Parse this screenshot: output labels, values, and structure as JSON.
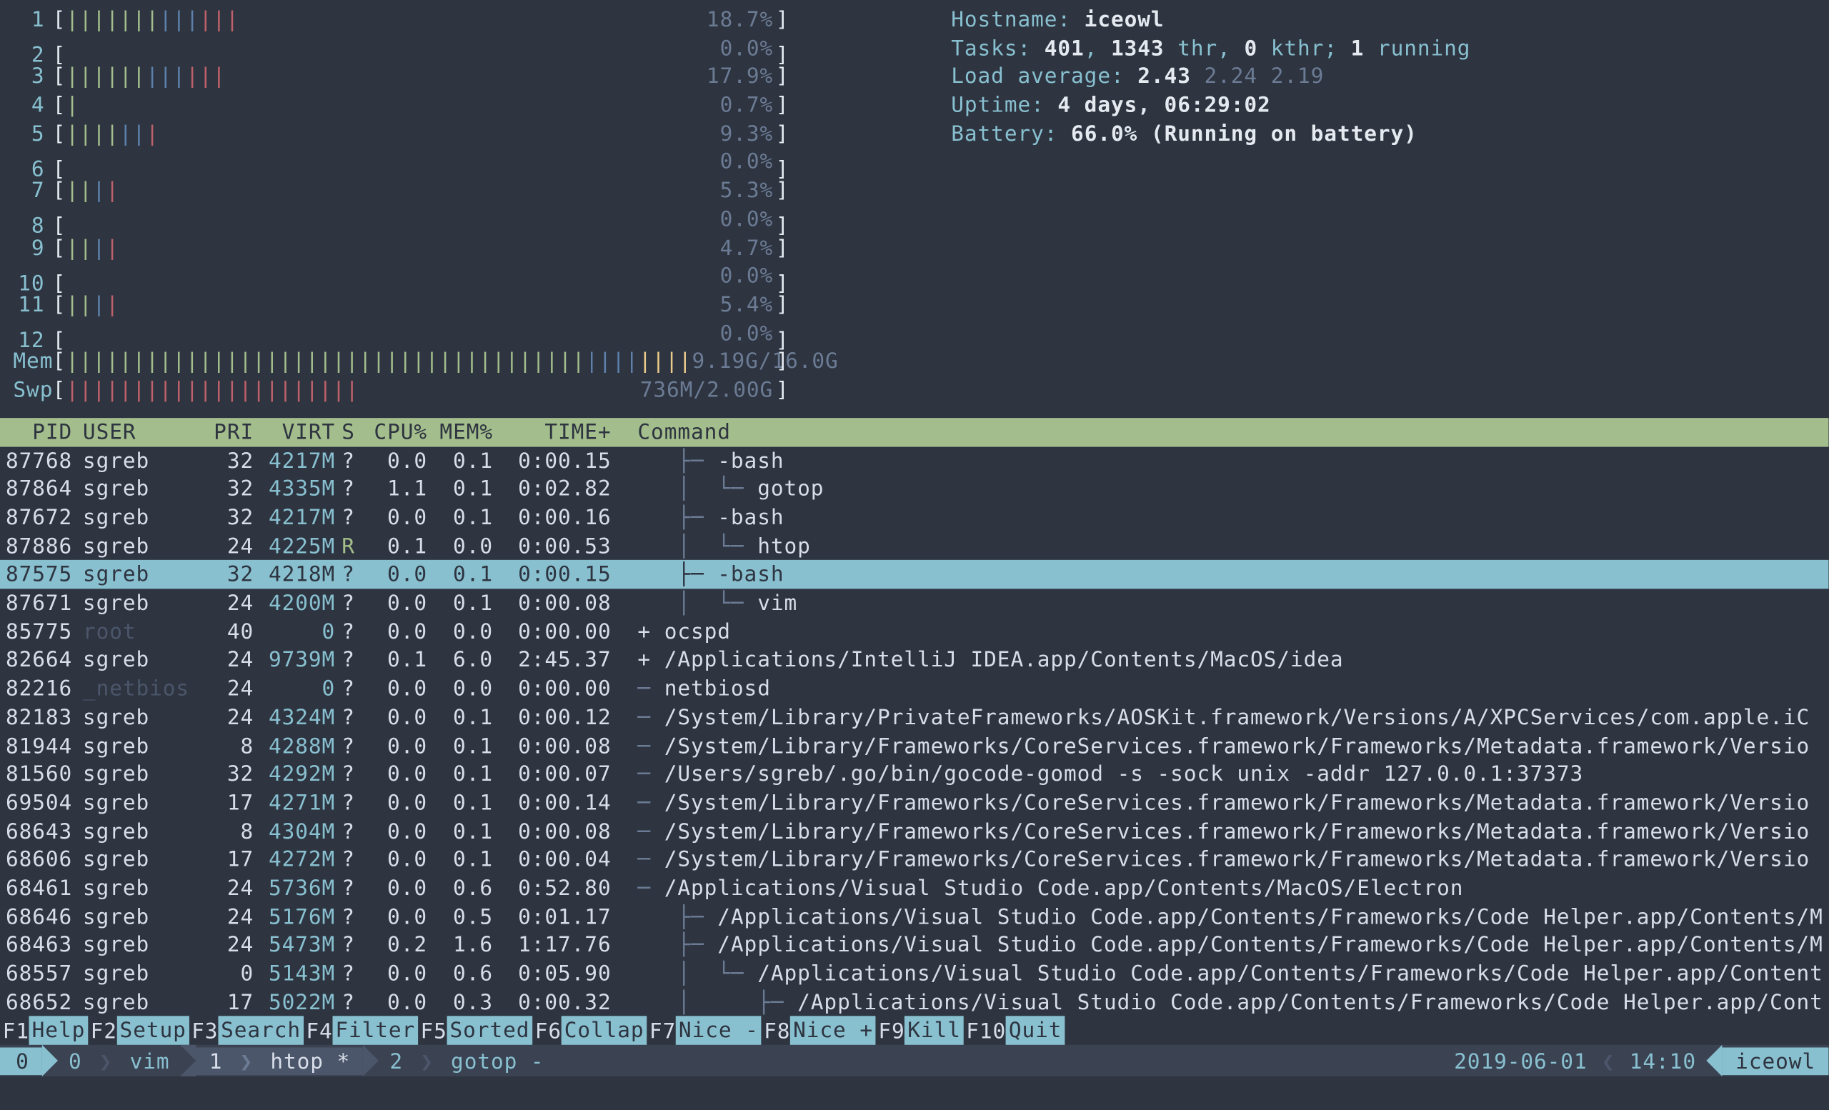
{
  "cpus": [
    {
      "n": "1",
      "bars": "|||||||||||||",
      "pct": "18.7%"
    },
    {
      "n": "2",
      "bars": "",
      "pct": "0.0%"
    },
    {
      "n": "3",
      "bars": "||||||||||||",
      "pct": "17.9%"
    },
    {
      "n": "4",
      "bars": "|",
      "pct": "0.7%"
    },
    {
      "n": "5",
      "bars": "|||||||",
      "pct": "9.3%"
    },
    {
      "n": "6",
      "bars": "",
      "pct": "0.0%"
    },
    {
      "n": "7",
      "bars": "||||",
      "pct": "5.3%"
    },
    {
      "n": "8",
      "bars": "",
      "pct": "0.0%"
    },
    {
      "n": "9",
      "bars": "||||",
      "pct": "4.7%"
    },
    {
      "n": "10",
      "bars": "",
      "pct": "0.0%"
    },
    {
      "n": "11",
      "bars": "||||",
      "pct": "5.4%"
    },
    {
      "n": "12",
      "bars": "",
      "pct": "0.0%"
    }
  ],
  "mem": {
    "label": "Mem",
    "bars_g": "|||||||||||||||||||||||||||||||||||||||",
    "bars_b": "||||",
    "bars_y": "||||",
    "val": "9.19G/16.0G"
  },
  "swp": {
    "label": "Swp",
    "bars_r": "||||||||||||||||||||||",
    "val": "736M/2.00G"
  },
  "info": {
    "hostname_label": "Hostname: ",
    "hostname": "iceowl",
    "tasks_label": "Tasks: ",
    "tasks": "401",
    "tasks_thr": "1343",
    "tasks_thr_label": " thr, ",
    "tasks_kthr": "0",
    "tasks_kthr_label": " kthr; ",
    "tasks_running": "1",
    "tasks_running_label": " running",
    "load_label": "Load average: ",
    "load1": "2.43",
    "load2": "2.24",
    "load3": "2.19",
    "uptime_label": "Uptime: ",
    "uptime": "4 days, 06:29:02",
    "battery_label": "Battery: ",
    "battery": "66.0% (Running on battery)"
  },
  "header": {
    "pid": "PID",
    "user": "USER",
    "pri": "PRI",
    "virt": "VIRT",
    "s": "S",
    "cpu": "CPU%",
    "mem": "MEM%",
    "time": "TIME+",
    "cmd": "Command"
  },
  "processes": [
    {
      "pid": "87768",
      "user": "sgreb",
      "pri": "32",
      "virt": "4217M",
      "s": "?",
      "cpu": "0.0",
      "mem": "0.1",
      "time": "0:00.15",
      "tree": "   ├─ ",
      "cmd": "-bash"
    },
    {
      "pid": "87864",
      "user": "sgreb",
      "pri": "32",
      "virt": "4335M",
      "s": "?",
      "cpu": "1.1",
      "mem": "0.1",
      "time": "0:02.82",
      "tree": "   │  └─ ",
      "cmd": "gotop"
    },
    {
      "pid": "87672",
      "user": "sgreb",
      "pri": "32",
      "virt": "4217M",
      "s": "?",
      "cpu": "0.0",
      "mem": "0.1",
      "time": "0:00.16",
      "tree": "   ├─ ",
      "cmd": "-bash"
    },
    {
      "pid": "87886",
      "user": "sgreb",
      "pri": "24",
      "virt": "4225M",
      "s": "R",
      "cpu": "0.1",
      "mem": "0.0",
      "time": "0:00.53",
      "tree": "   │  └─ ",
      "cmd": "htop",
      "stateR": true
    },
    {
      "pid": "87575",
      "user": "sgreb",
      "pri": "32",
      "virt": "4218M",
      "s": "?",
      "cpu": "0.0",
      "mem": "0.1",
      "time": "0:00.15",
      "tree": "   ├─ ",
      "cmd": "-bash",
      "selected": true
    },
    {
      "pid": "87671",
      "user": "sgreb",
      "pri": "24",
      "virt": "4200M",
      "s": "?",
      "cpu": "0.0",
      "mem": "0.1",
      "time": "0:00.08",
      "tree": "   │  └─ ",
      "cmd": "vim"
    },
    {
      "pid": "85775",
      "user": "root",
      "pri": "40",
      "virt": "0",
      "s": "?",
      "cpu": "0.0",
      "mem": "0.0",
      "time": "0:00.00",
      "tree": "",
      "pfx": "+ ",
      "cmd": "ocspd",
      "userDim": true
    },
    {
      "pid": "82664",
      "user": "sgreb",
      "pri": "24",
      "virt": "9739M",
      "s": "?",
      "cpu": "0.1",
      "mem": "6.0",
      "time": "2:45.37",
      "tree": "",
      "pfx": "+ ",
      "cmd": "/Applications/IntelliJ IDEA.app/Contents/MacOS/idea"
    },
    {
      "pid": "82216",
      "user": "_netbios",
      "pri": "24",
      "virt": "0",
      "s": "?",
      "cpu": "0.0",
      "mem": "0.0",
      "time": "0:00.00",
      "tree": "─ ",
      "cmd": "netbiosd",
      "userDim": true
    },
    {
      "pid": "82183",
      "user": "sgreb",
      "pri": "24",
      "virt": "4324M",
      "s": "?",
      "cpu": "0.0",
      "mem": "0.1",
      "time": "0:00.12",
      "tree": "─ ",
      "cmd": "/System/Library/PrivateFrameworks/AOSKit.framework/Versions/A/XPCServices/com.apple.iC"
    },
    {
      "pid": "81944",
      "user": "sgreb",
      "pri": "8",
      "virt": "4288M",
      "s": "?",
      "cpu": "0.0",
      "mem": "0.1",
      "time": "0:00.08",
      "tree": "─ ",
      "cmd": "/System/Library/Frameworks/CoreServices.framework/Frameworks/Metadata.framework/Versio"
    },
    {
      "pid": "81560",
      "user": "sgreb",
      "pri": "32",
      "virt": "4292M",
      "s": "?",
      "cpu": "0.0",
      "mem": "0.1",
      "time": "0:00.07",
      "tree": "─ ",
      "cmd": "/Users/sgreb/.go/bin/gocode-gomod -s -sock unix -addr 127.0.0.1:37373"
    },
    {
      "pid": "69504",
      "user": "sgreb",
      "pri": "17",
      "virt": "4271M",
      "s": "?",
      "cpu": "0.0",
      "mem": "0.1",
      "time": "0:00.14",
      "tree": "─ ",
      "cmd": "/System/Library/Frameworks/CoreServices.framework/Frameworks/Metadata.framework/Versio"
    },
    {
      "pid": "68643",
      "user": "sgreb",
      "pri": "8",
      "virt": "4304M",
      "s": "?",
      "cpu": "0.0",
      "mem": "0.1",
      "time": "0:00.08",
      "tree": "─ ",
      "cmd": "/System/Library/Frameworks/CoreServices.framework/Frameworks/Metadata.framework/Versio"
    },
    {
      "pid": "68606",
      "user": "sgreb",
      "pri": "17",
      "virt": "4272M",
      "s": "?",
      "cpu": "0.0",
      "mem": "0.1",
      "time": "0:00.04",
      "tree": "─ ",
      "cmd": "/System/Library/Frameworks/CoreServices.framework/Frameworks/Metadata.framework/Versio"
    },
    {
      "pid": "68461",
      "user": "sgreb",
      "pri": "24",
      "virt": "5736M",
      "s": "?",
      "cpu": "0.0",
      "mem": "0.6",
      "time": "0:52.80",
      "tree": "─ ",
      "cmd": "/Applications/Visual Studio Code.app/Contents/MacOS/Electron"
    },
    {
      "pid": "68646",
      "user": "sgreb",
      "pri": "24",
      "virt": "5176M",
      "s": "?",
      "cpu": "0.0",
      "mem": "0.5",
      "time": "0:01.17",
      "tree": "   ├─ ",
      "cmd": "/Applications/Visual Studio Code.app/Contents/Frameworks/Code Helper.app/Contents/M"
    },
    {
      "pid": "68463",
      "user": "sgreb",
      "pri": "24",
      "virt": "5473M",
      "s": "?",
      "cpu": "0.2",
      "mem": "1.6",
      "time": "1:17.76",
      "tree": "   ├─ ",
      "cmd": "/Applications/Visual Studio Code.app/Contents/Frameworks/Code Helper.app/Contents/M"
    },
    {
      "pid": "68557",
      "user": "sgreb",
      "pri": "0",
      "virt": "5143M",
      "s": "?",
      "cpu": "0.0",
      "mem": "0.6",
      "time": "0:05.90",
      "tree": "   │  └─ ",
      "cmd": "/Applications/Visual Studio Code.app/Contents/Frameworks/Code Helper.app/Content"
    },
    {
      "pid": "68652",
      "user": "sgreb",
      "pri": "17",
      "virt": "5022M",
      "s": "?",
      "cpu": "0.0",
      "mem": "0.3",
      "time": "0:00.32",
      "tree": "   │     ├─ ",
      "cmd": "/Applications/Visual Studio Code.app/Contents/Frameworks/Code Helper.app/Cont"
    }
  ],
  "footer": [
    {
      "key": "F1",
      "label": "Help  "
    },
    {
      "key": "F2",
      "label": "Setup "
    },
    {
      "key": "F3",
      "label": "Search"
    },
    {
      "key": "F4",
      "label": "Filter"
    },
    {
      "key": "F5",
      "label": "Sorted"
    },
    {
      "key": "F6",
      "label": "Collap"
    },
    {
      "key": "F7",
      "label": "Nice -"
    },
    {
      "key": "F8",
      "label": "Nice +"
    },
    {
      "key": "F9",
      "label": "Kill  "
    },
    {
      "key": "F10",
      "label": "Quit  "
    }
  ],
  "tmux": {
    "session": "0",
    "windows": [
      {
        "idx": "0",
        "name": "vim",
        "active": false
      },
      {
        "idx": "1",
        "name": "htop *",
        "active": true
      },
      {
        "idx": "2",
        "name": "gotop -",
        "active": false
      }
    ],
    "date": "2019-06-01",
    "time": "14:10",
    "host": "iceowl"
  }
}
